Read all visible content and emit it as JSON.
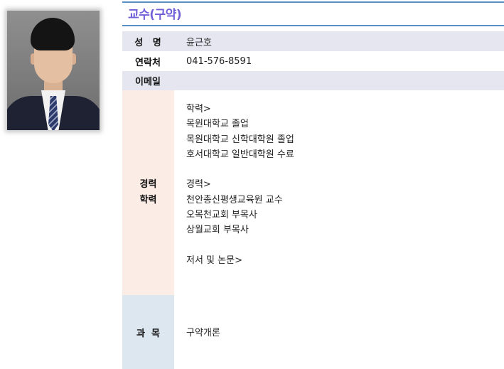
{
  "title": "교수(구약)",
  "profile": {
    "name_label": "성   명",
    "name": "윤근호",
    "contact_label": "연락처",
    "contact": "041-576-8591",
    "email_label": "이메일",
    "email": ""
  },
  "career": {
    "label_line1": "경력",
    "label_line2": "학력",
    "lines": [
      "학력>",
      "목원대학교 졸업",
      "목원대학교 신학대학원 졸업",
      "호서대학교 일반대학원 수료",
      "",
      "경력>",
      "천안총신평생교육원 교수",
      "오목천교회 부목사",
      "상월교회 부목사",
      "",
      "저서 및 논문>"
    ]
  },
  "course": {
    "label": "과  목",
    "value": "구약개론"
  }
}
